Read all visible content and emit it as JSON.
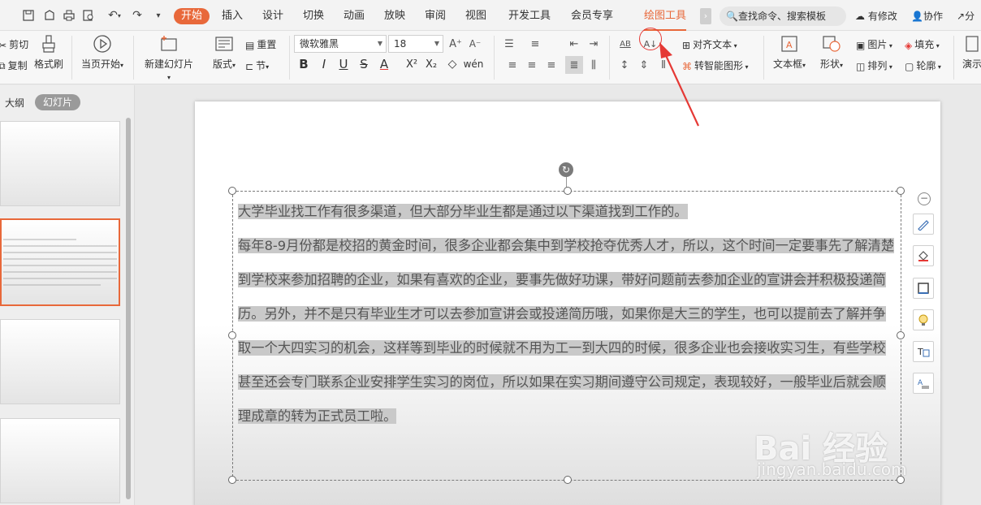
{
  "tabs": {
    "start": "开始",
    "insert": "插入",
    "design": "设计",
    "transition": "切换",
    "animation": "动画",
    "slideshow": "放映",
    "review": "审阅",
    "view": "视图",
    "developer": "开发工具",
    "member": "会员专享",
    "drawing_tools": "绘图工具"
  },
  "search": {
    "placeholder": "查找命令、搜索模板"
  },
  "right_tools": {
    "modified": "有修改",
    "collab": "协作",
    "share": "分"
  },
  "ribbon": {
    "cut": "剪切",
    "copy": "复制",
    "format_painter": "格式刷",
    "from_current": "当页开始",
    "new_slide": "新建幻灯片",
    "layout": "版式",
    "reset": "重置",
    "section": "节",
    "font_name": "微软雅黑",
    "font_size": "18",
    "align_text": "对齐文本",
    "smart_shape": "转智能图形",
    "textbox": "文本框",
    "shape": "形状",
    "picture": "图片",
    "fill": "填充",
    "arrange": "排列",
    "outline": "轮廓",
    "present": "演示"
  },
  "left_panel": {
    "outline_tab": "大纲",
    "slides_tab": "幻灯片"
  },
  "slide": {
    "text": "大学毕业找工作有很多渠道，但大部分毕业生都是通过以下渠道找到工作的。\n每年8-9月份都是校招的黄金时间，很多企业都会集中到学校抢夺优秀人才，所以，这个时间一定要事先了解清楚到学校来参加招聘的企业，如果有喜欢的企业，要事先做好功课，带好问题前去参加企业的宣讲会并积极投递简历。另外，并不是只有毕业生才可以去参加宣讲会或投递简历哦，如果你是大三的学生，也可以提前去了解并争取一个大四实习的机会，这样等到毕业的时候就不用为工一到大四的时候，很多企业也会接收实习生，有些学校甚至还会专门联系企业安排学生实习的岗位，所以如果在实习期间遵守公司规定，表现较好，一般毕业后就会顺理成章的转为正式员工啦。"
  },
  "watermark": {
    "brand": "Bai 经验",
    "url": "jingyan.baidu.com"
  },
  "colors": {
    "accent": "#e8683a",
    "annotation": "#e53935"
  }
}
